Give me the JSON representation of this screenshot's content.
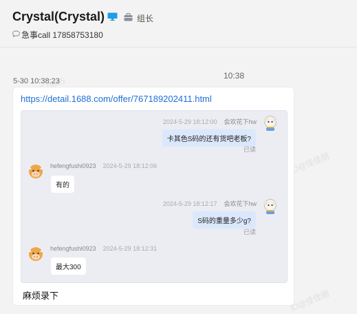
{
  "header": {
    "contact_name": "Crystal(Crystal)",
    "device_icon": "desktop-icon",
    "role_icon": "group-leader-icon",
    "role_label": "组长",
    "signature_icon": "speech-bubble-icon",
    "signature": "急事call 17858753180"
  },
  "conversation": {
    "message_timestamp": "5-30 10:38:23",
    "center_time": "10:38",
    "card": {
      "link": "https://detail.1688.com/offer/767189202411.html",
      "note": "麻烦录下",
      "forwarded_messages": [
        {
          "side": "right",
          "sender": "会欢花下hw",
          "time": "2024-5-29 18:12:00",
          "text": "卡其色S码的还有货吧老板?",
          "status": "已读",
          "avatar": "sheep-avatar-icon"
        },
        {
          "side": "left",
          "sender": "hefengfushi0923",
          "time": "2024-5-29 18:12:06",
          "text": "有的",
          "avatar": "cow-avatar-icon"
        },
        {
          "side": "right",
          "sender": "会欢花下hw",
          "time": "2024-5-29 18:12:17",
          "text": "S码的重量多少g?",
          "status": "已读",
          "avatar": "sheep-avatar-icon"
        },
        {
          "side": "left",
          "sender": "hefengfushi0923",
          "time": "2024-5-29 18:12:31",
          "text": "最大300",
          "avatar": "cow-avatar-icon"
        }
      ]
    }
  },
  "colors": {
    "link": "#1d6fd9",
    "right_bubble": "#dbe8fb",
    "background": "#f3f3f3"
  }
}
